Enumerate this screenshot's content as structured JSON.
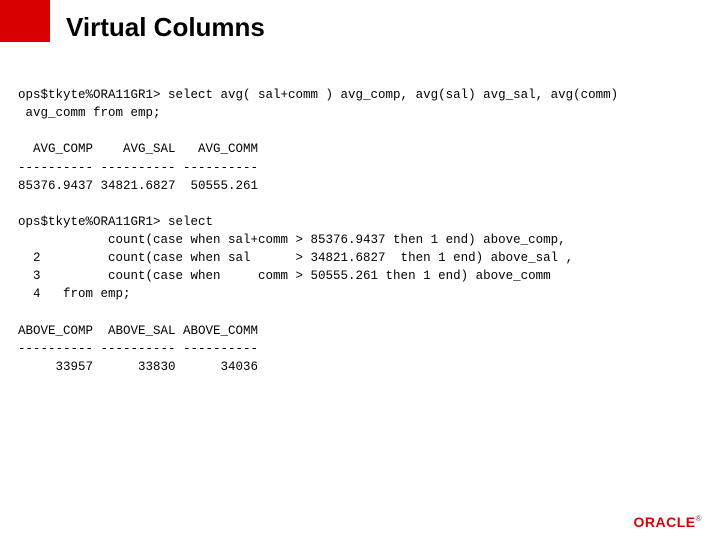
{
  "title": "Virtual Columns",
  "code": "ops$tkyte%ORA11GR1> select avg( sal+comm ) avg_comp, avg(sal) avg_sal, avg(comm)\n avg_comm from emp;\n\n  AVG_COMP    AVG_SAL   AVG_COMM\n---------- ---------- ----------\n85376.9437 34821.6827  50555.261\n\nops$tkyte%ORA11GR1> select\n            count(case when sal+comm > 85376.9437 then 1 end) above_comp,\n  2         count(case when sal      > 34821.6827  then 1 end) above_sal ,\n  3         count(case when     comm > 50555.261 then 1 end) above_comm\n  4   from emp;\n\nABOVE_COMP  ABOVE_SAL ABOVE_COMM\n---------- ---------- ----------\n     33957      33830      34036",
  "logo": "ORACLE",
  "chart_data": {
    "type": "table",
    "tables": [
      {
        "title": "Averages from emp",
        "columns": [
          "AVG_COMP",
          "AVG_SAL",
          "AVG_COMM"
        ],
        "rows": [
          [
            85376.9437,
            34821.6827,
            50555.261
          ]
        ]
      },
      {
        "title": "Counts above average",
        "columns": [
          "ABOVE_COMP",
          "ABOVE_SAL",
          "ABOVE_COMM"
        ],
        "rows": [
          [
            33957,
            33830,
            34036
          ]
        ]
      }
    ]
  }
}
